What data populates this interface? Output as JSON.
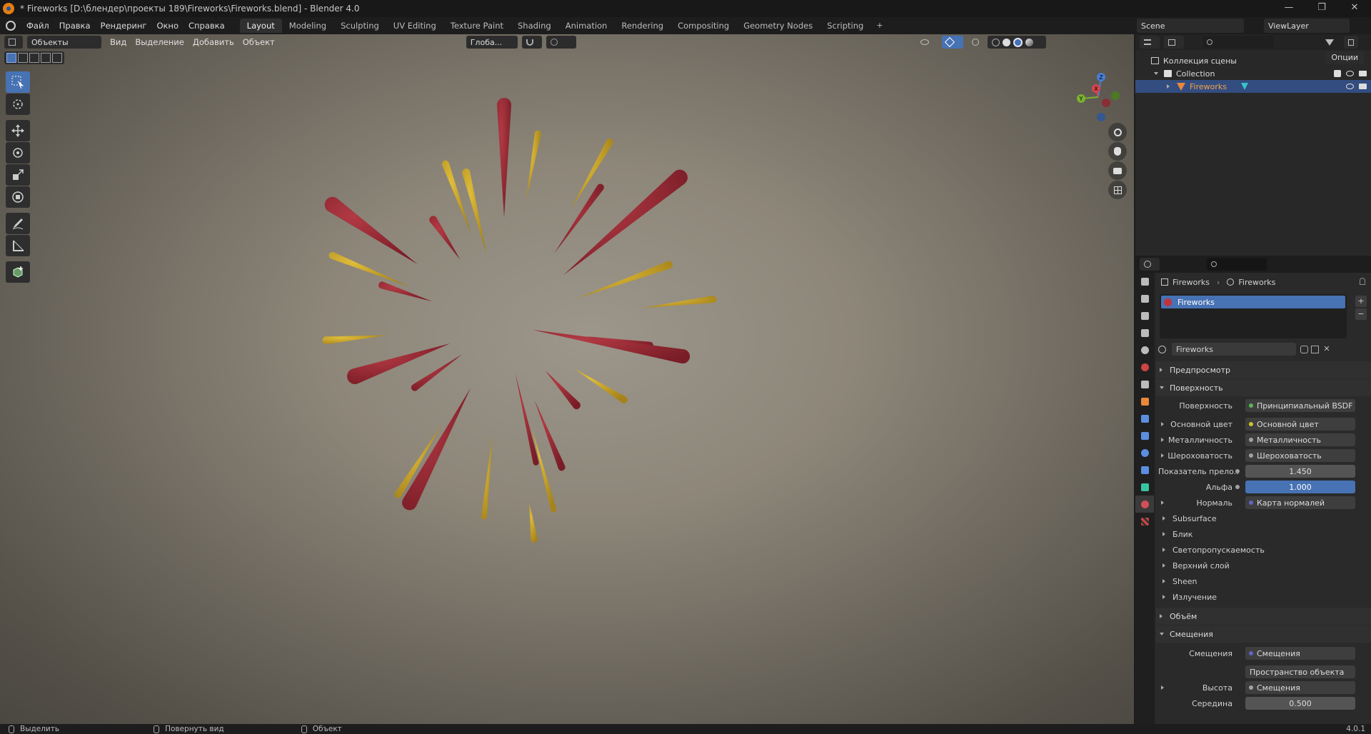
{
  "window": {
    "title": "* Fireworks [D:\\блендер\\проекты 189\\Fireworks\\Fireworks.blend] - Blender 4.0",
    "min": "—",
    "max": "❐",
    "close": "✕"
  },
  "menu": [
    "Файл",
    "Правка",
    "Рендеринг",
    "Окно",
    "Справка"
  ],
  "workspaces": [
    "Layout",
    "Modeling",
    "Sculpting",
    "UV Editing",
    "Texture Paint",
    "Shading",
    "Animation",
    "Rendering",
    "Compositing",
    "Geometry Nodes",
    "Scripting"
  ],
  "workspace_plus": "+",
  "scene": {
    "name": "Scene",
    "viewlayer": "ViewLayer"
  },
  "viewport_header": {
    "mode": "Объекты",
    "menus": [
      "Вид",
      "Выделение",
      "Добавить",
      "Объект"
    ],
    "transform_orientation": "Глоба...",
    "options": "Опции"
  },
  "gizmo": {
    "z": "Z",
    "x": "X",
    "y": "Y"
  },
  "outliner": {
    "root": "Коллекция сцены",
    "collection": "Collection",
    "object": "Fireworks"
  },
  "properties": {
    "breadcrumb_object": "Fireworks",
    "breadcrumb_material": "Fireworks",
    "slot": "Fireworks",
    "material_name": "Fireworks",
    "sections": {
      "preview": "Предпросмотр",
      "surface": "Поверхность",
      "volume": "Объём",
      "displacement": "Смещения"
    },
    "surface_rows": [
      {
        "label": "Поверхность",
        "value": "Принципиальный BSDF",
        "dot": "#5ab55a",
        "expand": false
      },
      {
        "label": "Основной цвет",
        "value": "Основной цвет",
        "dot": "#c7c729",
        "expand": true
      },
      {
        "label": "Металличность",
        "value": "Металличность",
        "dot": "#a1a1a1",
        "expand": true
      },
      {
        "label": "Шероховатость",
        "value": "Шероховатость",
        "dot": "#a1a1a1",
        "expand": true
      }
    ],
    "ior": {
      "label": "Показатель прело...",
      "value": "1.450"
    },
    "alpha": {
      "label": "Альфа",
      "value": "1.000"
    },
    "normal": {
      "label": "Нормаль",
      "value": "Карта нормалей"
    },
    "subpanels": [
      "Subsurface",
      "Блик",
      "Светопропускаемость",
      "Верхний слой",
      "Sheen",
      "Излучение"
    ],
    "displacement_rows": {
      "label": "Смещения",
      "value": "Смещения",
      "space": "Пространство объекта",
      "height_label": "Высота",
      "height_value": "Смещения",
      "mid_label": "Середина",
      "mid_value": "0.500"
    }
  },
  "status": {
    "select": "Выделить",
    "rotate": "Повернуть вид",
    "object": "Объект",
    "version": "4.0.1"
  },
  "colors": {
    "red": "#8f2530",
    "yellow": "#c9a326",
    "accent": "#4772b3"
  }
}
